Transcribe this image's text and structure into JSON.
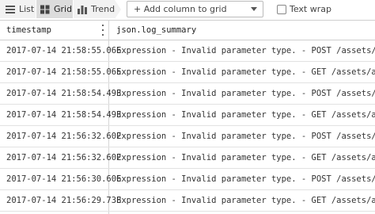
{
  "toolbar": {
    "view_tabs": [
      {
        "label": "List",
        "icon": "list-icon"
      },
      {
        "label": "Grid",
        "icon": "grid-icon",
        "active": true
      },
      {
        "label": "Trend",
        "icon": "bar-chart-icon"
      }
    ],
    "add_column_label": "+ Add column to grid",
    "text_wrap_label": "Text wrap",
    "text_wrap_checked": false
  },
  "table": {
    "columns": [
      "timestamp",
      "json.log_summary"
    ],
    "rows": [
      {
        "timestamp": "2017-07-14 21:58:55.066",
        "log_summary": "Expression - Invalid parameter type. - POST /assets/apps/d/proc"
      },
      {
        "timestamp": "2017-07-14 21:58:55.065",
        "log_summary": "Expression - Invalid parameter type. - GET /assets/apps/d/proj"
      },
      {
        "timestamp": "2017-07-14 21:58:54.493",
        "log_summary": "Expression - Invalid parameter type. - POST /assets/apps/d/proc"
      },
      {
        "timestamp": "2017-07-14 21:58:54.493",
        "log_summary": "Expression - Invalid parameter type. - GET /assets/apps/d/proj"
      },
      {
        "timestamp": "2017-07-14 21:56:32.602",
        "log_summary": "Expression - Invalid parameter type. - POST /assets/apps/d/proc"
      },
      {
        "timestamp": "2017-07-14 21:56:32.602",
        "log_summary": "Expression - Invalid parameter type. - GET /assets/apps/d/proj"
      },
      {
        "timestamp": "2017-07-14 21:56:30.606",
        "log_summary": "Expression - Invalid parameter type. - POST /assets/apps/d/proc"
      },
      {
        "timestamp": "2017-07-14 21:56:29.738",
        "log_summary": "Expression - Invalid parameter type. - GET /assets/apps/d/proj"
      }
    ]
  },
  "colors": {
    "toolbar_bg": "#f2f2f2",
    "active_tab_bg": "#dcdcdc",
    "border": "#cfcfcf"
  }
}
